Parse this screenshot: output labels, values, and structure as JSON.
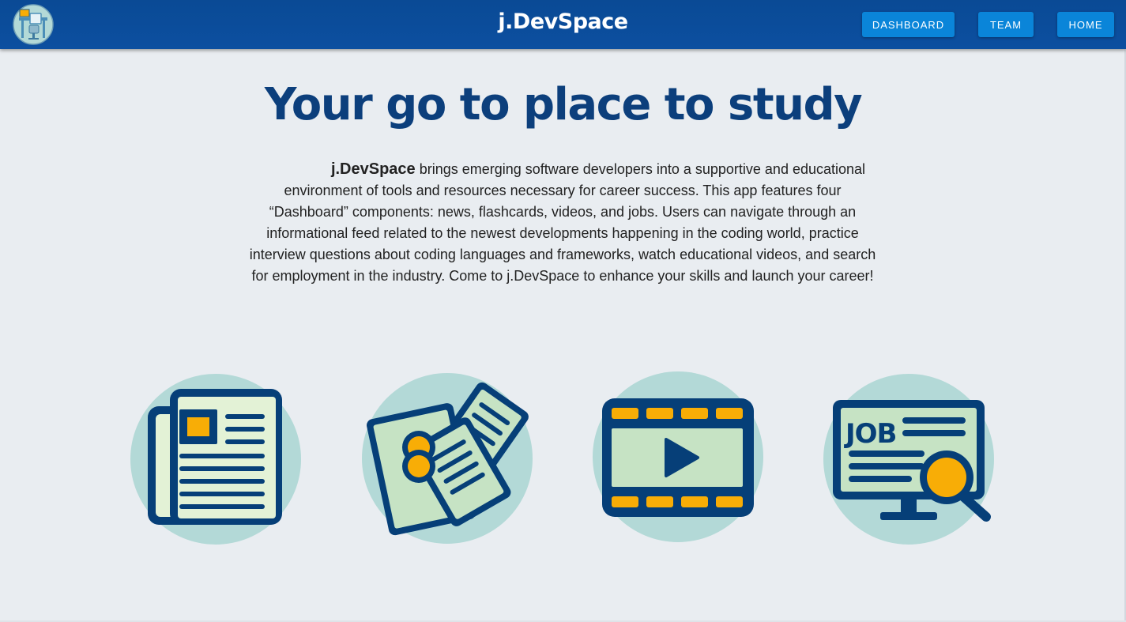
{
  "header": {
    "brand": "j.DevSpace",
    "logo_icon": "desk-workstation-icon",
    "nav": {
      "dashboard_label": "DASHBOARD",
      "team_label": "TEAM",
      "home_label": "HOME"
    }
  },
  "hero": {
    "title": "Your go to place to study",
    "intro_brand": "j.DevSpace",
    "intro_text": "brings emerging software developers into a supportive and educational environment of tools and resources necessary for career success. This app features four “Dashboard” components: news, flashcards, videos, and jobs. Users can navigate through an informational feed related to the newest developments happening in the coding world, practice interview questions about coding languages and frameworks, watch educational videos, and search for employment in the industry. Come to j.DevSpace to enhance your skills and launch your career!"
  },
  "features": [
    {
      "icon": "newspaper-icon"
    },
    {
      "icon": "flashcards-icon"
    },
    {
      "icon": "video-player-icon"
    },
    {
      "icon": "job-search-icon"
    }
  ],
  "colors": {
    "appbar": "#0c4fa0",
    "nav_button": "#0a85d9",
    "headline": "#0c3f7c",
    "icon_circle": "#b3d9d7",
    "icon_stroke": "#063f78",
    "icon_fill_light": "#c6e3c4",
    "icon_accent": "#f8ad06",
    "page_bg": "#e9edf1"
  }
}
